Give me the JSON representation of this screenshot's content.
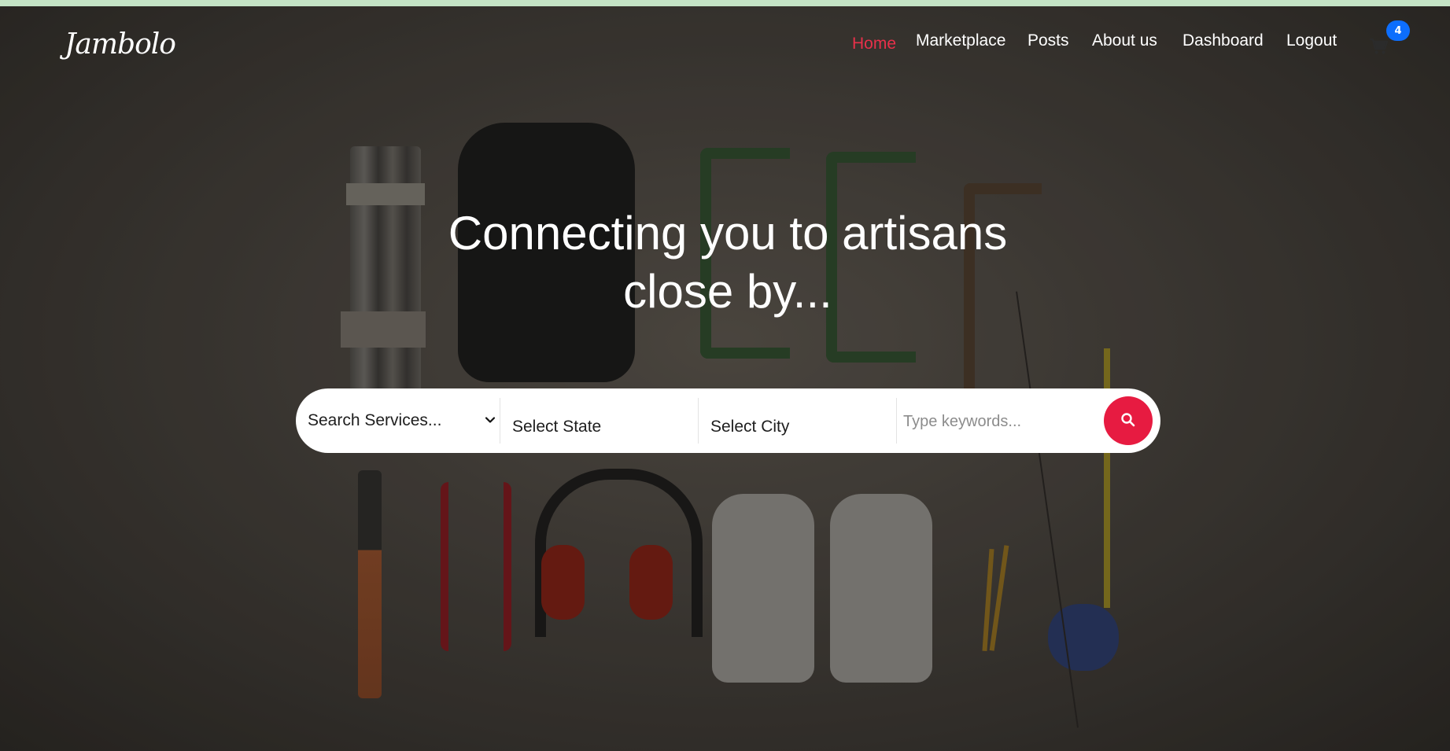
{
  "brand": {
    "logo_text": "Jambolo"
  },
  "nav": {
    "items": [
      {
        "label": "Home",
        "active": true
      },
      {
        "label": "Marketplace",
        "active": false
      },
      {
        "label": "Posts",
        "active": false
      },
      {
        "label": "About us",
        "active": false
      },
      {
        "label": "Dashboard",
        "active": false
      },
      {
        "label": "Logout",
        "active": false
      }
    ],
    "cart": {
      "icon": "shopping-cart-icon",
      "count": "4"
    }
  },
  "hero": {
    "headline_line1": "Connecting you to artisans",
    "headline_line2": "close by..."
  },
  "search": {
    "services_selected": "Search Services...",
    "state_selected": "Select State",
    "city_selected": "Select City",
    "keywords_placeholder": "Type keywords...",
    "keywords_value": "",
    "button_icon": "search-icon"
  },
  "colors": {
    "accent": "#e71b41",
    "nav_active": "#e8304a",
    "badge": "#0d6efd",
    "top_strip": "#c4e3c5"
  }
}
